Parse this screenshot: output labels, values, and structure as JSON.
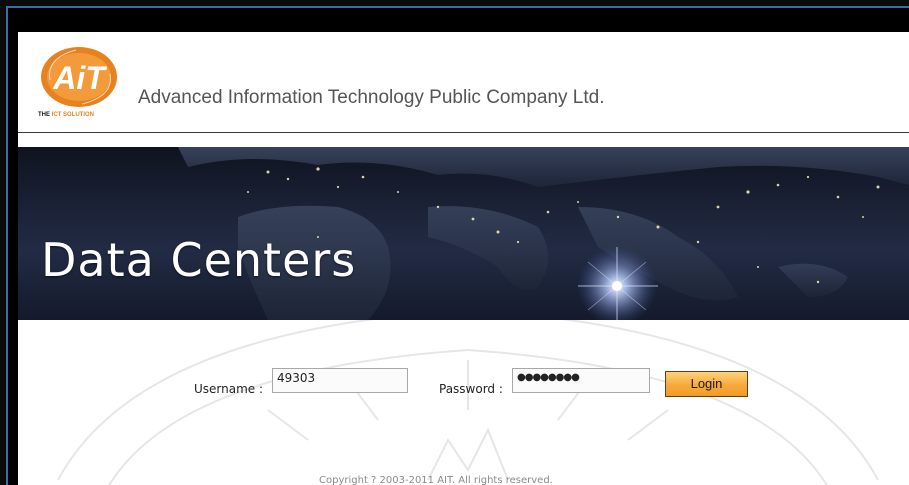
{
  "header": {
    "logo_text": "AiT",
    "logo_tagline_prefix": "THE",
    "logo_tagline_suffix": "ICT SOLUTION",
    "company_name": "Advanced Information Technology Public Company Ltd."
  },
  "banner": {
    "title": "Data Centers"
  },
  "login_form": {
    "username_label": "Username :",
    "username_value": "49303",
    "password_label": "Password :",
    "password_value": "●●●●●●●●",
    "login_label": "Login"
  },
  "footer": {
    "copyright": "Copyright ? 2003-2011 AIT. All rights reserved."
  },
  "colors": {
    "logo_orange": "#e8821e",
    "button_orange": "#f7a93c",
    "banner_dark": "#1b2236"
  }
}
